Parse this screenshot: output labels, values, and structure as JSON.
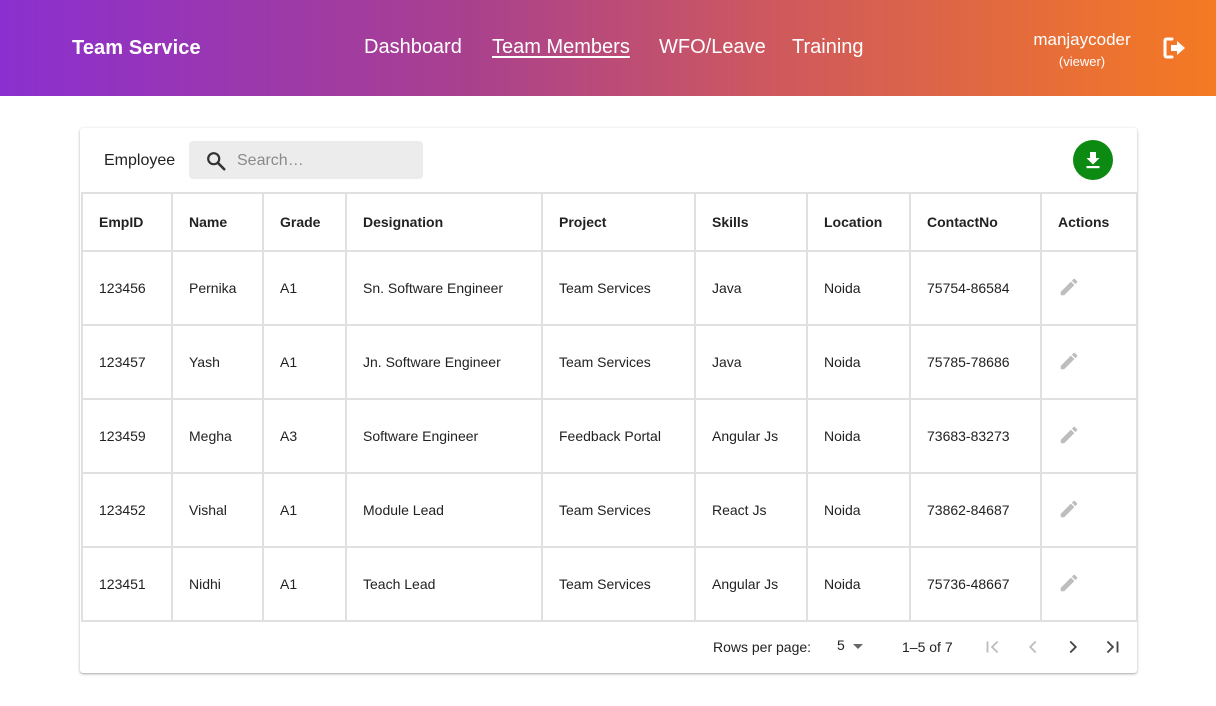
{
  "header": {
    "brand": "Team Service",
    "nav": [
      {
        "label": "Dashboard"
      },
      {
        "label": "Team Members",
        "active": true
      },
      {
        "label": "WFO/Leave"
      },
      {
        "label": "Training"
      }
    ],
    "user": {
      "name": "manjaycoder",
      "role": "(viewer)"
    },
    "logout_icon": "logout-icon"
  },
  "toolbar": {
    "label": "Employee",
    "search_placeholder": "Search…",
    "search_value": "",
    "download_icon": "download-icon",
    "download_color": "#0d8a12"
  },
  "table": {
    "columns": [
      "EmpID",
      "Name",
      "Grade",
      "Designation",
      "Project",
      "Skills",
      "Location",
      "ContactNo",
      "Actions"
    ],
    "rows": [
      [
        "123456",
        "Pernika",
        "A1",
        "Sn. Software Engineer",
        "Team Services",
        "Java",
        "Noida",
        "75754-86584"
      ],
      [
        "123457",
        "Yash",
        "A1",
        "Jn. Software Engineer",
        "Team Services",
        "Java",
        "Noida",
        "75785-78686"
      ],
      [
        "123459",
        "Megha",
        "A3",
        "Software Engineer",
        "Feedback Portal",
        "Angular Js",
        "Noida",
        "73683-83273"
      ],
      [
        "123452",
        "Vishal",
        "A1",
        "Module Lead",
        "Team Services",
        "React Js",
        "Noida",
        "73862-84687"
      ],
      [
        "123451",
        "Nidhi",
        "A1",
        "Teach Lead",
        "Team Services",
        "Angular Js",
        "Noida",
        "75736-48667"
      ]
    ],
    "row_action_icon": "edit-icon"
  },
  "pagination": {
    "rows_per_page_label": "Rows per page:",
    "rows_per_page": "5",
    "range": "1–5 of 7"
  },
  "colors": {
    "header_gradient_start": "#8b2fd0",
    "header_gradient_end": "#f57a22"
  }
}
